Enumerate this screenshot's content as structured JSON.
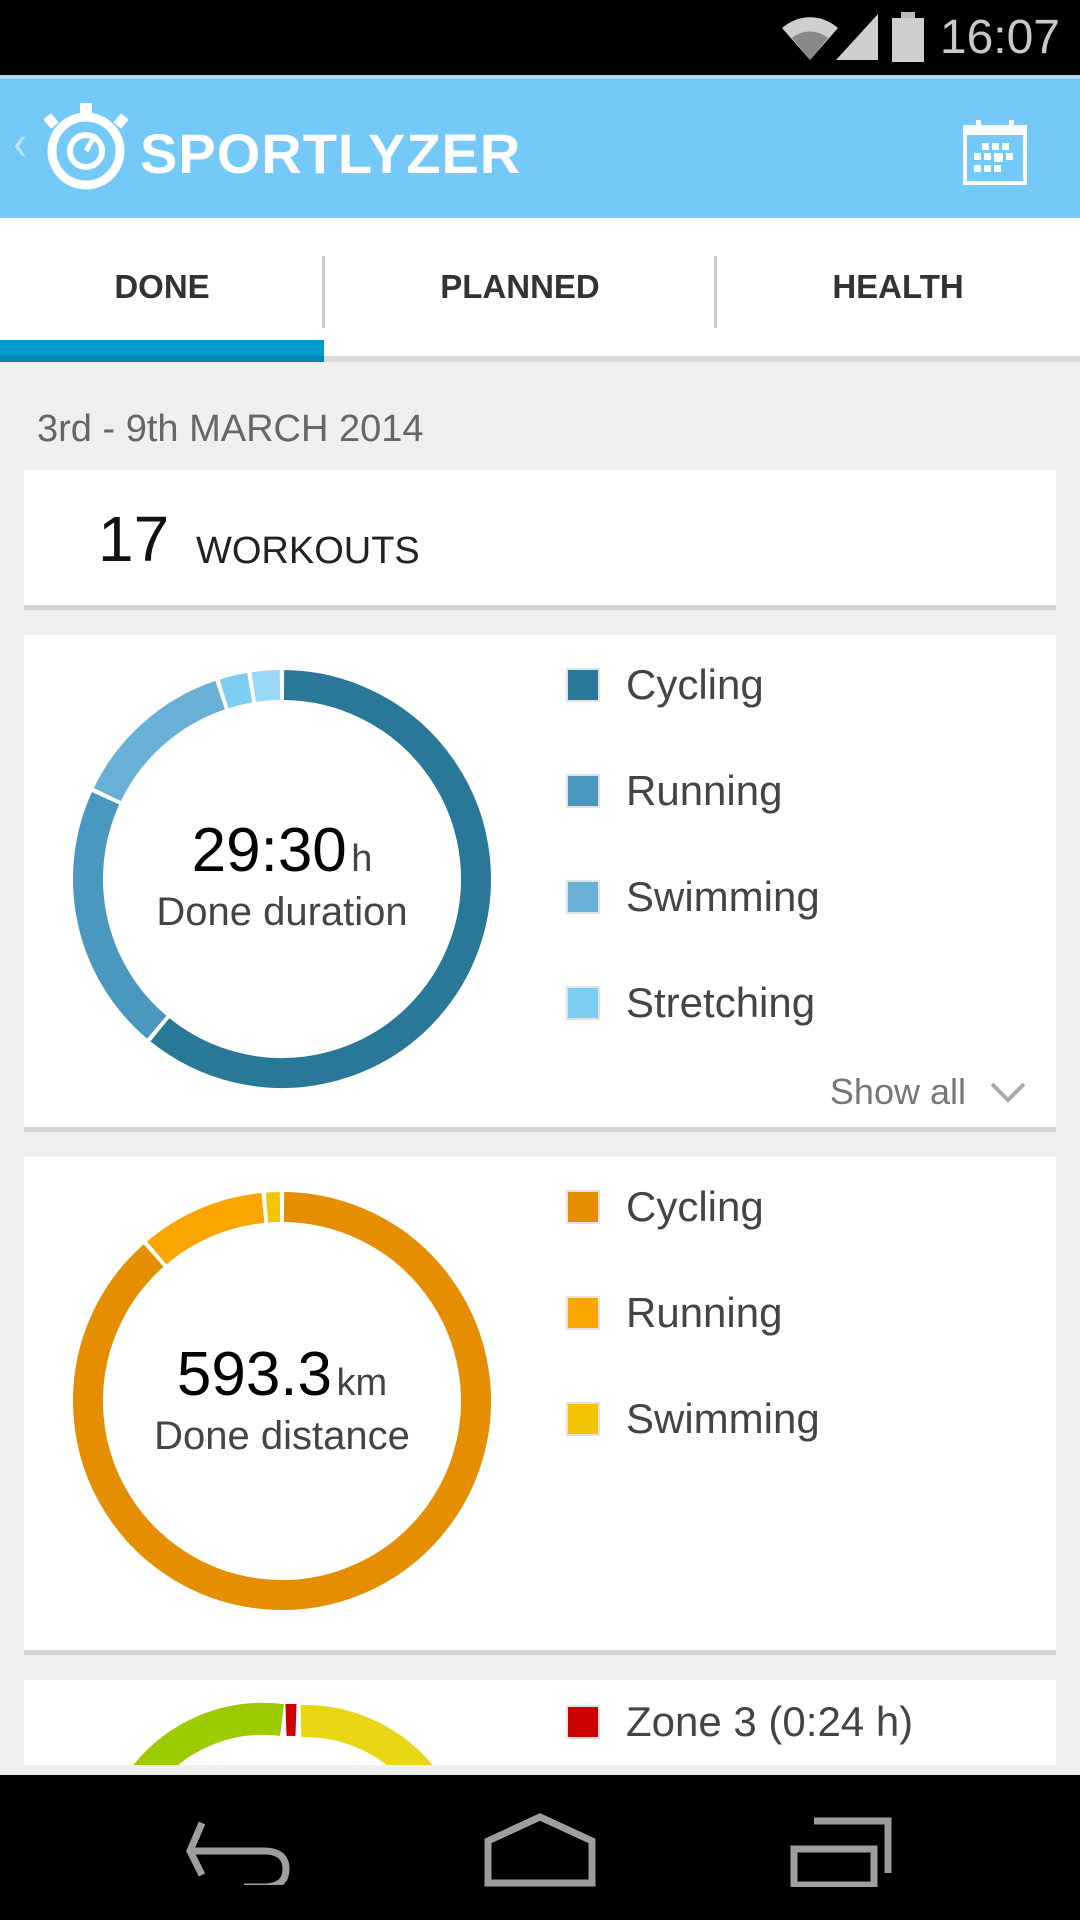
{
  "status_bar": {
    "time": "16:07",
    "icons": [
      "wifi-icon",
      "signal-icon",
      "battery-icon"
    ]
  },
  "app_bar": {
    "title": "SPORTLYZER",
    "logo": "stopwatch-icon",
    "action": "calendar-icon",
    "color": "#74c9f9"
  },
  "tabs": [
    {
      "label": "DONE",
      "active": true
    },
    {
      "label": "PLANNED",
      "active": false
    },
    {
      "label": "HEALTH",
      "active": false
    }
  ],
  "date_range": "3rd - 9th MARCH 2014",
  "workouts": {
    "count": "17",
    "label": "WORKOUTS"
  },
  "chart_data": [
    {
      "type": "pie",
      "title": "Done duration",
      "value": "29:30",
      "unit": "h",
      "categories": [
        "Cycling",
        "Running",
        "Swimming",
        "Stretching",
        ""
      ],
      "values": [
        61,
        21,
        13,
        2.5,
        2.5
      ],
      "colors": [
        "#2a7898",
        "#4a98c0",
        "#68b0d5",
        "#7dcdf0",
        "#9ad9f5"
      ],
      "show_all": "Show all"
    },
    {
      "type": "pie",
      "title": "Done distance",
      "value": "593.3",
      "unit": "km",
      "categories": [
        "Cycling",
        "Running",
        "Swimming"
      ],
      "values": [
        526,
        59,
        8.3
      ],
      "colors": [
        "#e58e00",
        "#fba500",
        "#f2c500"
      ]
    },
    {
      "type": "pie",
      "categories": [
        "Zone 3 (0:24 h)"
      ],
      "colors": [
        "#cc0000",
        "#9ccc00",
        "#e8d514",
        "#6aa000"
      ]
    }
  ],
  "nav_bar": [
    "back-icon",
    "home-icon",
    "recents-icon"
  ]
}
